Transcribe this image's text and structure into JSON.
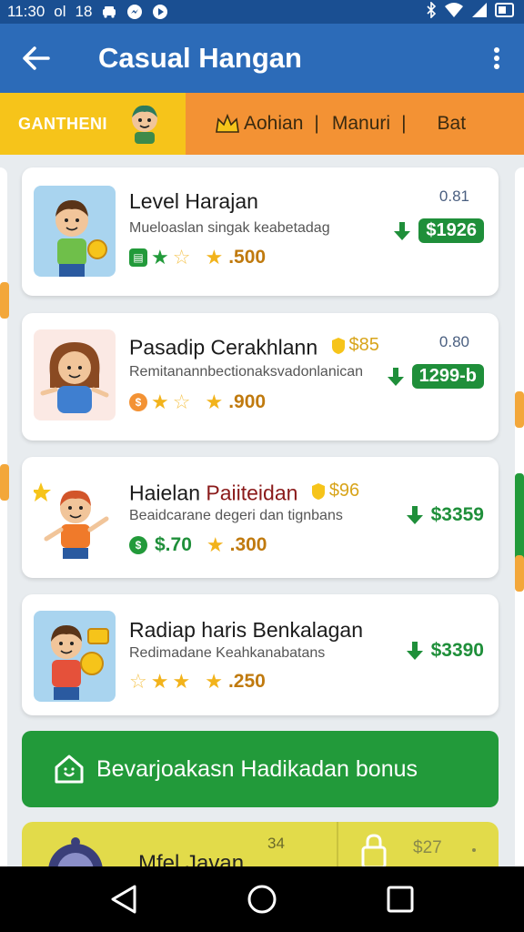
{
  "status_bar": {
    "time": "11:30",
    "label_a": "ol",
    "label_b": "18"
  },
  "app_bar": {
    "title": "Casual Hangan"
  },
  "tabs": {
    "primary": "GANTHENI",
    "items": [
      {
        "label": "Aohian",
        "separator": "|"
      },
      {
        "label": "Manuri",
        "separator": "|"
      },
      {
        "label": "Bat",
        "separator": ""
      }
    ]
  },
  "cards": [
    {
      "title": "Level Harajan",
      "subtitle": "Mueloaslan singak keabetadag",
      "rating": ".500",
      "top_value": "0.81",
      "price": "$1926",
      "stars_full": 1,
      "stars_empty": 1
    },
    {
      "title": "Pasadip Cerakhlann",
      "coin_value": "$85",
      "subtitle": "Remitanannbectionaksvadonlanican",
      "rating": ".900",
      "top_value": "0.80",
      "price": "1299-b",
      "stars_full": 1,
      "stars_empty": 1
    },
    {
      "title_a": "Haielan",
      "title_b": "Paiiteidan",
      "coin_value": "$96",
      "subtitle": "Beaidcarane degeri dan tignbans",
      "badge_value": "$.70",
      "rating": ".300",
      "price": "$3359"
    },
    {
      "title": "Radiap haris Benkalagan",
      "subtitle": "Redimadane Keahkanabatans",
      "rating": ".250",
      "price": "$3390",
      "stars_full": 2,
      "stars_empty": 1
    }
  ],
  "bonus": {
    "label": "Bevarjoakasn Hadikadan bonus"
  },
  "partial_card": {
    "title": "Mfel Javan",
    "num_a": "34",
    "num_b": "$27"
  },
  "colors": {
    "app_bar": "#2c6bb8",
    "status_bar": "#1a4f92",
    "tab_yellow": "#f6c41a",
    "tab_orange": "#f39234",
    "price_green": "#1f8f3a",
    "star": "#f2b31b"
  }
}
